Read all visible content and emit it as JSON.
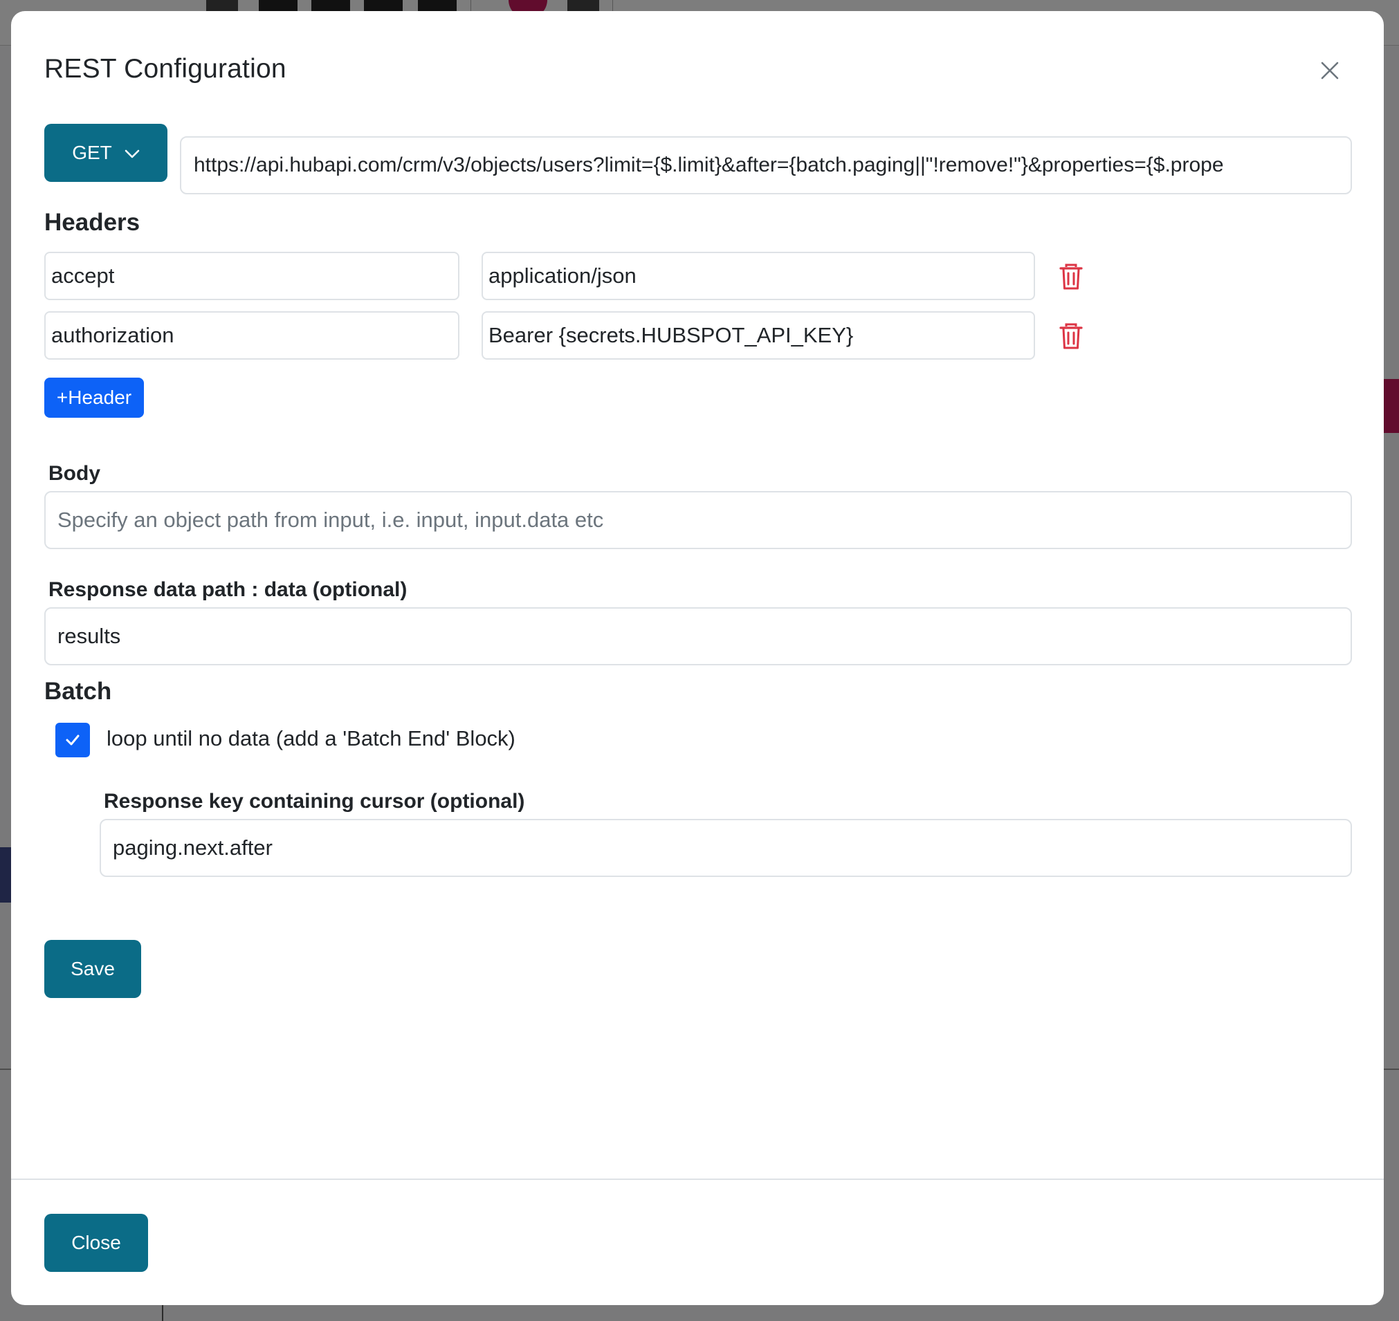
{
  "modal": {
    "title": "REST Configuration",
    "close_icon": "close-icon"
  },
  "request": {
    "method": "GET",
    "url": "https://api.hubapi.com/crm/v3/objects/users?limit={$.limit}&after={batch.paging||\"!remove!\"}&properties={$.prope"
  },
  "headers": {
    "title": "Headers",
    "rows": [
      {
        "key": "accept",
        "value": "application/json"
      },
      {
        "key": "authorization",
        "value": "Bearer {secrets.HUBSPOT_API_KEY}"
      }
    ],
    "add_label": "+Header"
  },
  "body": {
    "label": "Body",
    "placeholder": "Specify an object path from input, i.e. input, input.data etc",
    "value": ""
  },
  "response_path": {
    "label": "Response data path : data (optional)",
    "value": "results"
  },
  "batch": {
    "title": "Batch",
    "loop_label": "loop until no data (add a 'Batch End' Block)",
    "loop_checked": true,
    "cursor_label": "Response key containing cursor (optional)",
    "cursor_value": "paging.next.after"
  },
  "actions": {
    "save_label": "Save",
    "close_label": "Close"
  },
  "colors": {
    "primary_teal": "#0b6c87",
    "primary_blue": "#0d62f7",
    "danger_red": "#dc3545"
  }
}
